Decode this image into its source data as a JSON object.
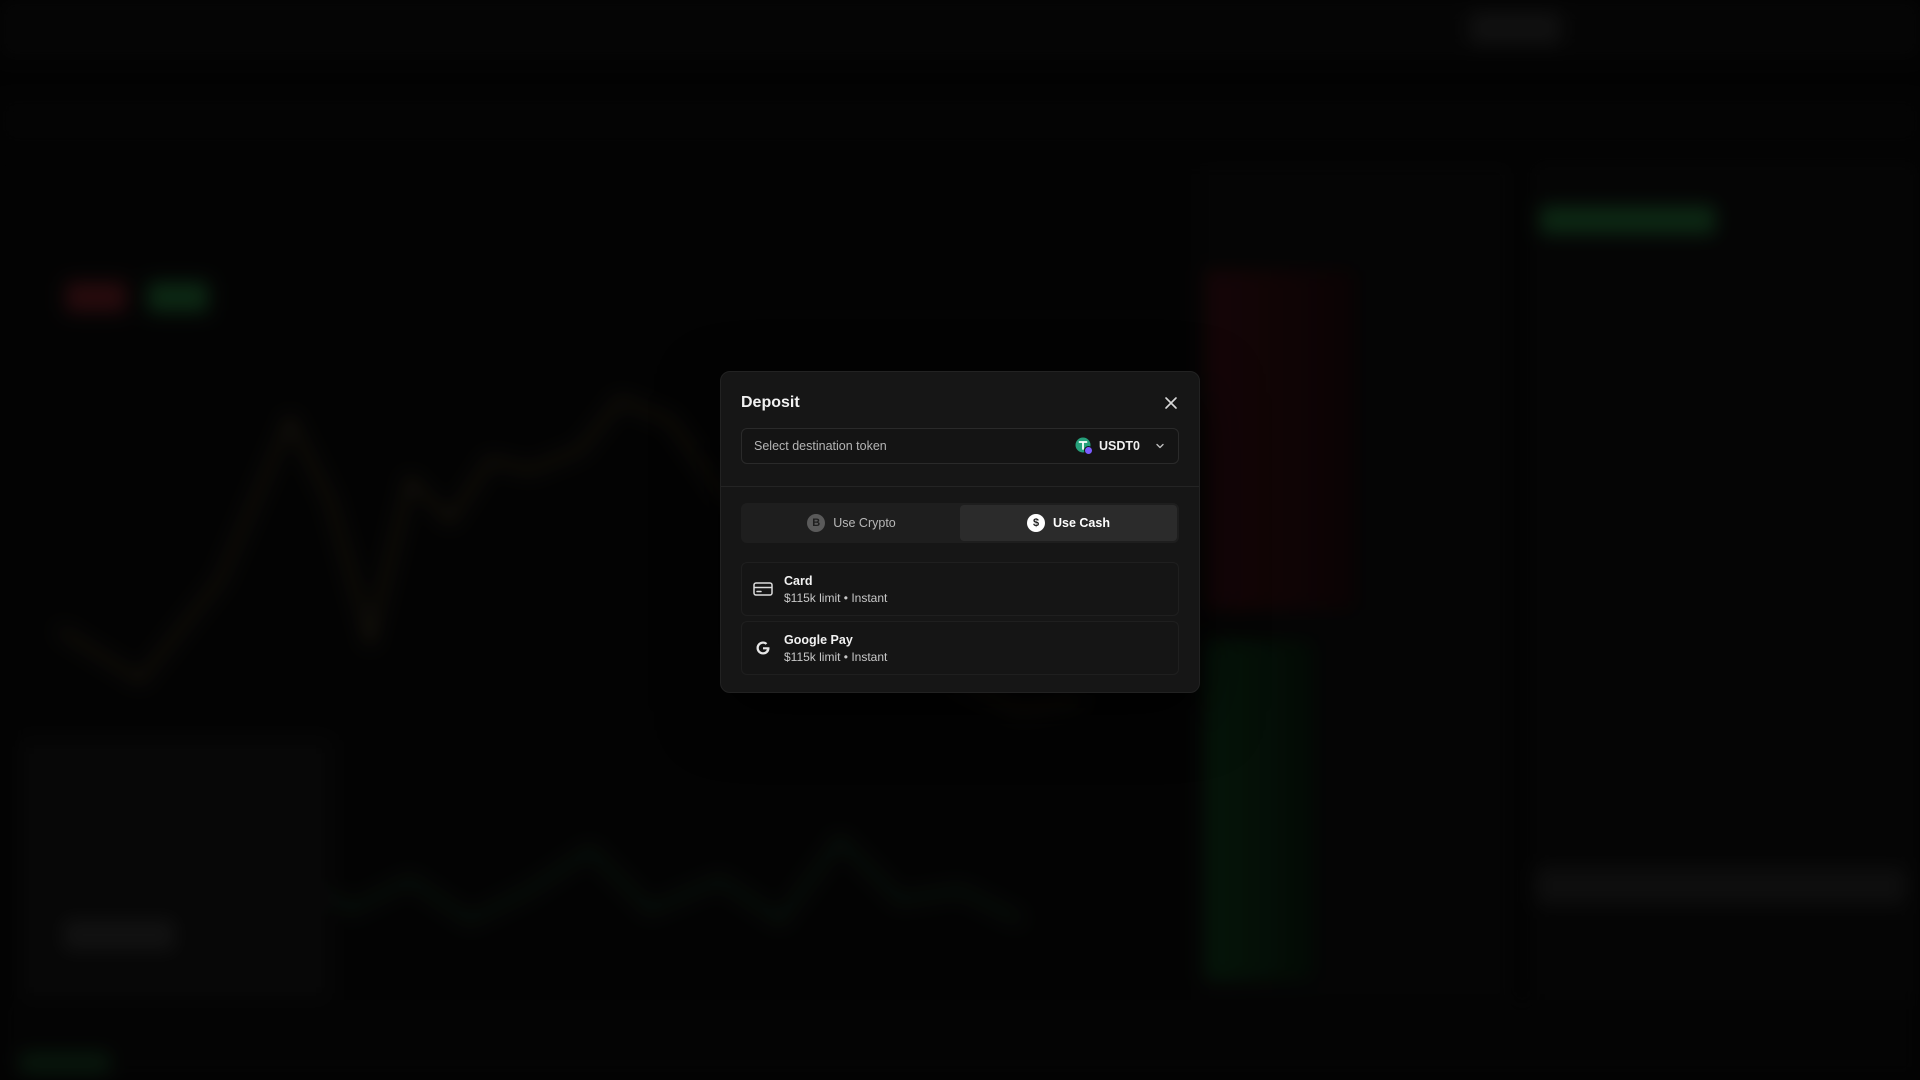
{
  "modal": {
    "title": "Deposit",
    "token_select": {
      "label": "Select destination token",
      "selected": "USDT0"
    },
    "tabs": [
      {
        "label": "Use Crypto",
        "icon": "bitcoin-icon",
        "active": false
      },
      {
        "label": "Use Cash",
        "icon": "dollar-icon",
        "active": true
      }
    ],
    "methods": [
      {
        "title": "Card",
        "subtitle": "$115k limit • Instant",
        "icon": "credit-card-icon"
      },
      {
        "title": "Google Pay",
        "subtitle": "$115k limit • Instant",
        "icon": "google-icon"
      }
    ]
  },
  "colors": {
    "modal_bg": "#161616",
    "tab_active_bg": "#2b2b2b",
    "token_green": "#26a17b",
    "token_purple": "#7b5cff"
  }
}
